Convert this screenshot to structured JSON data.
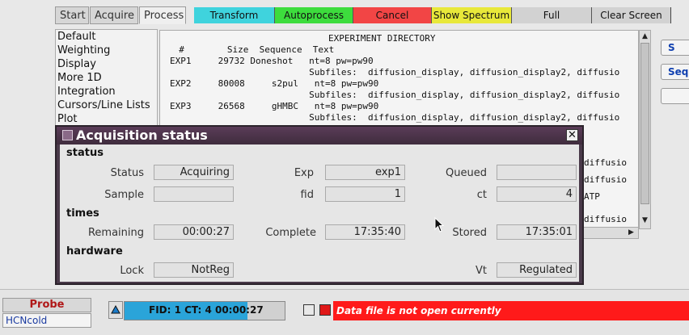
{
  "tabs": [
    {
      "label": "Start"
    },
    {
      "label": "Acquire"
    },
    {
      "label": "Process"
    }
  ],
  "actions": {
    "transform": "Transform",
    "autoprocess": "Autoprocess",
    "cancel": "Cancel",
    "show_spectrum": "Show Spectrum",
    "full": "Full",
    "clear_screen": "Clear Screen"
  },
  "colors": {
    "transform": "#3fd3dd",
    "autoprocess": "#3ddc3d",
    "cancel": "#f24545",
    "show_spectrum": "#e8e83a",
    "gray": "#d2d2d2",
    "error": "#ff1a1a",
    "progress": "#2aa4d9"
  },
  "menu": [
    "Default",
    "Weighting",
    "Display",
    "More 1D",
    "Integration",
    "Cursors/Line Lists",
    "Plot"
  ],
  "directory": {
    "title": "EXPERIMENT DIRECTORY",
    "header": "  #        Size  Sequence  Text",
    "lines": [
      "EXP1     29732 Doneshot   nt=8 pw=pw90",
      "                          Subfiles:  diffusion_display, diffusion_display2, diffusio",
      "EXP2     80008     s2pul   nt=8 pw=pw90",
      "                          Subfiles:  diffusion_display, diffusion_display2, diffusio",
      "EXP3     26568     gHMBC   nt=8 pw=pw90",
      "                          Subfiles:  diffusion_display, diffusion_display2, diffusio"
    ],
    "peek": [
      "diffusio",
      "diffusio",
      "ATP",
      "diffusio"
    ]
  },
  "right_buttons": [
    "S",
    "Seq",
    ""
  ],
  "dialog": {
    "title": "Acquisition status",
    "sections": {
      "status": "status",
      "times": "times",
      "hardware": "hardware"
    },
    "fields": {
      "status": {
        "label": "Status",
        "value": "Acquiring"
      },
      "exp": {
        "label": "Exp",
        "value": "exp1"
      },
      "queued": {
        "label": "Queued",
        "value": ""
      },
      "sample": {
        "label": "Sample",
        "value": ""
      },
      "fid": {
        "label": "fid",
        "value": "1"
      },
      "ct": {
        "label": "ct",
        "value": "4"
      },
      "remaining": {
        "label": "Remaining",
        "value": "00:00:27"
      },
      "complete": {
        "label": "Complete",
        "value": "17:35:40"
      },
      "stored": {
        "label": "Stored",
        "value": "17:35:01"
      },
      "lock": {
        "label": "Lock",
        "value": "NotReg"
      },
      "vt": {
        "label": "Vt",
        "value": "Regulated"
      }
    }
  },
  "bottom": {
    "probe_label": "Probe",
    "probe_value": "HCNcold",
    "progress_text": "FID: 1 CT: 4  00:00:27",
    "progress_fraction": 0.77,
    "error_message": "Data file is not open currently"
  }
}
